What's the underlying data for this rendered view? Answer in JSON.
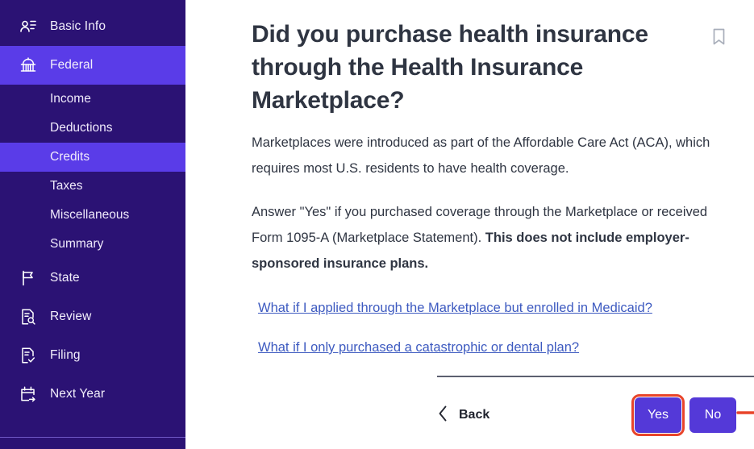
{
  "sidebar": {
    "items": [
      {
        "label": "Basic Info",
        "icon": "contact-card-icon",
        "active": false
      },
      {
        "label": "Federal",
        "icon": "capitol-building-icon",
        "active": true
      },
      {
        "label": "State",
        "icon": "flag-icon",
        "active": false
      },
      {
        "label": "Review",
        "icon": "document-search-icon",
        "active": false
      },
      {
        "label": "Filing",
        "icon": "document-check-icon",
        "active": false
      },
      {
        "label": "Next Year",
        "icon": "calendar-arrow-icon",
        "active": false
      }
    ],
    "federal_subitems": [
      {
        "label": "Income",
        "active": false
      },
      {
        "label": "Deductions",
        "active": false
      },
      {
        "label": "Credits",
        "active": true
      },
      {
        "label": "Taxes",
        "active": false
      },
      {
        "label": "Miscellaneous",
        "active": false
      },
      {
        "label": "Summary",
        "active": false
      }
    ],
    "colors": {
      "background": "#2b1274",
      "active": "#5a3ce8",
      "text": "#f2eefb"
    }
  },
  "main": {
    "title": "Did you purchase health insurance through the Health Insurance Marketplace?",
    "bookmark_icon": "bookmark-icon",
    "paragraph_1": "Marketplaces were introduced as part of the Affordable Care Act (ACA), which requires most U.S. residents to have health coverage.",
    "paragraph_2_normal": "Answer \"Yes\" if you purchased coverage through the Marketplace or received Form 1095-A (Marketplace Statement). ",
    "paragraph_2_bold": "This does not include employer-sponsored insurance plans.",
    "links": [
      "What if I applied through the Marketplace but enrolled in Medicaid?",
      "What if I only purchased a catastrophic or dental plan?"
    ],
    "link_color": "#3d5ac0"
  },
  "footer": {
    "back_label": "Back",
    "back_icon": "chevron-left-icon",
    "yes_label": "Yes",
    "no_label": "No",
    "button_color": "#5439d8",
    "highlight_color": "#e8442a"
  },
  "annotation": {
    "arrow_icon": "right-arrow-annotation",
    "arrow_color": "#e8442a",
    "points_to": "Yes"
  }
}
